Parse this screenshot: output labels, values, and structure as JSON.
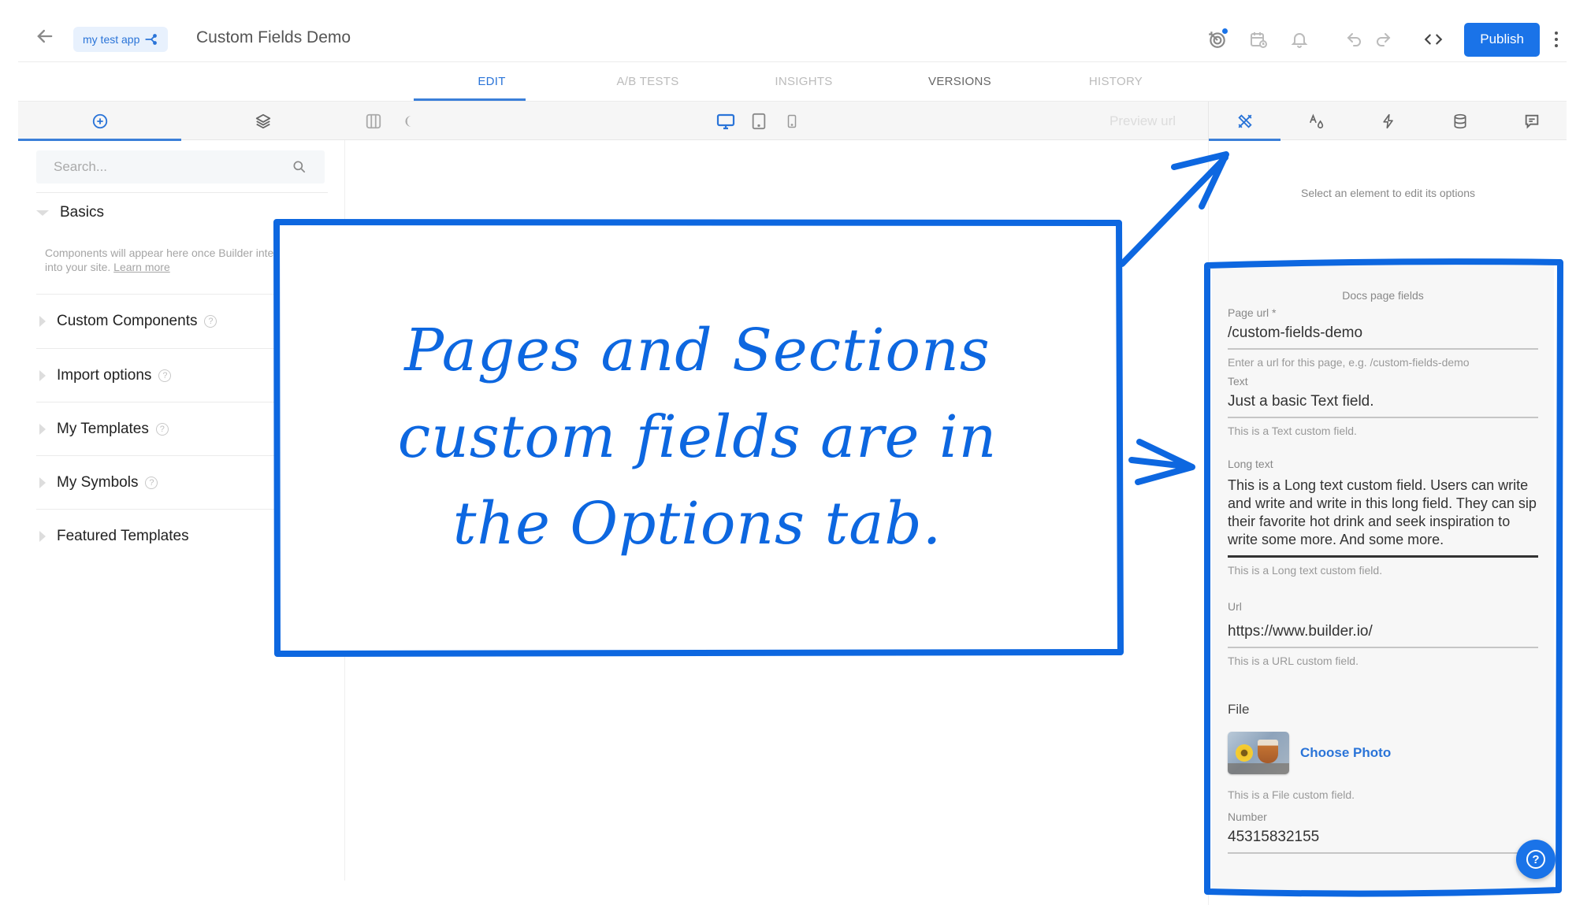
{
  "header": {
    "back_icon": "arrow-left-icon",
    "app_chip": {
      "label": "my test app",
      "icon": "share-nodes-icon"
    },
    "title": "Custom Fields Demo",
    "icons": [
      "target-icon",
      "calendar-clock-icon",
      "bell-icon",
      "undo-icon",
      "redo-icon",
      "code-icon"
    ],
    "publish_label": "Publish",
    "more_icon": "more-vertical-icon"
  },
  "main_tabs": [
    {
      "label": "EDIT",
      "state": "active"
    },
    {
      "label": "A/B TESTS",
      "state": "disabled"
    },
    {
      "label": "INSIGHTS",
      "state": "disabled"
    },
    {
      "label": "VERSIONS",
      "state": "normal"
    },
    {
      "label": "HISTORY",
      "state": "disabled"
    }
  ],
  "sidebar_tabs": [
    {
      "name": "insert",
      "icon": "plus-circle-icon",
      "active": true
    },
    {
      "name": "layers",
      "icon": "layers-icon",
      "active": false
    }
  ],
  "toolbar": {
    "left_icons": [
      "columns-icon",
      "moon-icon"
    ],
    "devices": [
      {
        "name": "desktop",
        "icon": "monitor-icon",
        "active": true
      },
      {
        "name": "tablet",
        "icon": "tablet-icon",
        "active": false
      },
      {
        "name": "mobile",
        "icon": "phone-icon",
        "active": false
      }
    ],
    "preview_url_label": "Preview url"
  },
  "options_tabs": [
    {
      "name": "options",
      "icon": "tools-icon",
      "active": true
    },
    {
      "name": "style",
      "icon": "text-style-icon",
      "active": false
    },
    {
      "name": "interactions",
      "icon": "lightning-icon",
      "active": false
    },
    {
      "name": "data",
      "icon": "database-icon",
      "active": false
    },
    {
      "name": "comments",
      "icon": "comment-icon",
      "active": false
    }
  ],
  "sidebar": {
    "search_placeholder": "Search...",
    "basics": {
      "label": "Basics",
      "hint": "Components will appear here once Builder integrated into your site.",
      "learn_more": "Learn more"
    },
    "sections": [
      {
        "label": "Custom Components",
        "help": true
      },
      {
        "label": "Import options",
        "help": true
      },
      {
        "label": "My Templates",
        "help": true
      },
      {
        "label": "My Symbols",
        "help": true
      },
      {
        "label": "Featured Templates",
        "help": false
      }
    ]
  },
  "right_panel": {
    "select_hint": "Select an element to edit its options",
    "fields_title": "Docs page fields",
    "fields": {
      "page_url": {
        "label": "Page url *",
        "value": "/custom-fields-demo",
        "help": "Enter a url for this page, e.g. /custom-fields-demo"
      },
      "text": {
        "label": "Text",
        "value": "Just a basic Text field.",
        "help": "This is a Text custom field."
      },
      "long_text": {
        "label": "Long text",
        "value": "This is a Long text custom field. Users can write and write and write in this long field. They can sip their favorite hot drink and seek inspiration to write some more. And some more.",
        "help": "This is a Long text custom field."
      },
      "url": {
        "label": "Url",
        "value": "https://www.builder.io/",
        "help": "This is a URL custom field."
      },
      "file": {
        "label": "File",
        "button": "Choose Photo",
        "help": "This is a File custom field."
      },
      "number": {
        "label": "Number",
        "value": "45315832155"
      }
    },
    "help_fab_icon": "question-circle-icon"
  },
  "annotation": {
    "lines": [
      "Pages and Sections",
      "custom fields are in",
      "the Options tab."
    ],
    "color": "#0d67e0"
  },
  "colors": {
    "accent": "#1a73e8",
    "annotation": "#0d67e0"
  }
}
